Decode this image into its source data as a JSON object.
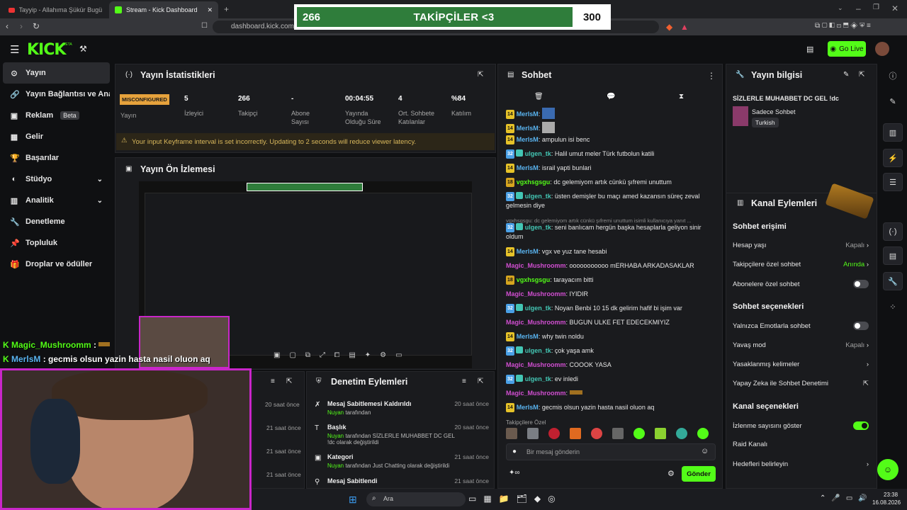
{
  "browser": {
    "tabs": [
      "Tayyip - Allahıma Şükür Bugün d...",
      "Stream - Kick Dashboard"
    ],
    "url": "dashboard.kick.com/st"
  },
  "goal": {
    "current": "266",
    "label": "TAKİPÇİLER <3",
    "target": "300",
    "fraction": 0.887
  },
  "kick": {
    "logo": "KICK",
    "beta": "BETA",
    "go_live": "Go Live"
  },
  "sidebar": {
    "items": [
      {
        "label": "Yayın",
        "icon": "broadcast-icon"
      },
      {
        "label": "Yayın Bağlantısı ve Anahtarı",
        "icon": "link-icon"
      },
      {
        "label": "Reklam",
        "icon": "ad-icon",
        "badge": "Beta"
      },
      {
        "label": "Gelir",
        "icon": "revenue-icon"
      },
      {
        "label": "Başarılar",
        "icon": "trophy-icon"
      },
      {
        "label": "Stüdyo",
        "icon": "studio-icon"
      },
      {
        "label": "Analitik",
        "icon": "chart-icon"
      },
      {
        "label": "Denetleme",
        "icon": "wrench-icon"
      },
      {
        "label": "Topluluk",
        "icon": "pin-icon"
      },
      {
        "label": "Droplar ve ödüller",
        "icon": "gift-icon"
      }
    ]
  },
  "stats": {
    "title": "Yayın İstatistikleri",
    "status": "MISCONFIGURED",
    "status_label": "Yayın",
    "items": [
      {
        "value": "5",
        "label": "İzleyici"
      },
      {
        "value": "266",
        "label": "Takipçi"
      },
      {
        "value": "-",
        "label": "Abone Sayısı"
      },
      {
        "value": "00:04:55",
        "label": "Yayında Olduğu Süre"
      },
      {
        "value": "4",
        "label": "Ort. Sohbete Katılanlar"
      },
      {
        "value": "%84",
        "label": "Katılım"
      }
    ],
    "warning": "Your input Keyframe interval is set incorrectly. Updating to 2 seconds will reduce viewer latency."
  },
  "preview": {
    "title": "Yayın Ön İzlemesi"
  },
  "chat": {
    "title": "Sohbet",
    "messages": [
      {
        "badge": "14",
        "user": "MerlsM",
        "color": "#5ab4f0",
        "text": ""
      },
      {
        "badge": "14",
        "user": "MerlsM",
        "color": "#5ab4f0",
        "text": ""
      },
      {
        "badge": "14",
        "user": "MerlsM",
        "color": "#5ab4f0",
        "text": "ampulun isi benc"
      },
      {
        "badge": "32",
        "user": "ulgen_tk",
        "color": "#43c6b4",
        "text": "Halil umut meler Türk futbolun katili"
      },
      {
        "badge": "14",
        "user": "MerlsM",
        "color": "#5ab4f0",
        "text": "israil yapti bunlari"
      },
      {
        "badge": "18",
        "user": "vgxhsgsgu",
        "color": "#53fc18",
        "text": "dc gelemiyom artık cünkü şıfremi unuttum"
      },
      {
        "badge": "32",
        "user": "ulgen_tk",
        "color": "#43c6b4",
        "text": "üsten demişler bu maçı amed kazansın süreç zeval gelmesin diye"
      },
      {
        "badge": "",
        "user": "",
        "color": "#8a8a8a",
        "text": "vgxhsgsgu: dc gelemiyom artık cünkü şıfremi unuttum isimli kullanıcıya yanıt ..."
      },
      {
        "badge": "32",
        "user": "ulgen_tk",
        "color": "#43c6b4",
        "text": "seni banlıcam hergün başka hesaplarla geliyon sinir oldum"
      },
      {
        "badge": "14",
        "user": "MerlsM",
        "color": "#5ab4f0",
        "text": "vgx ve yuz tane hesabi"
      },
      {
        "badge": "",
        "user": "Magic_Mushroomm",
        "color": "#d04ed0",
        "text": "ooooooooooo mERHABA ARKADASAKLAR"
      },
      {
        "badge": "18",
        "user": "vgxhsgsgu",
        "color": "#53fc18",
        "text": "tarayacım bitti"
      },
      {
        "badge": "",
        "user": "Magic_Mushroomm",
        "color": "#d04ed0",
        "text": "IYIDIR"
      },
      {
        "badge": "32",
        "user": "ulgen_tk",
        "color": "#43c6b4",
        "text": "Noyan Benbi 10 15 dk gelirim hafif bi işim var"
      },
      {
        "badge": "",
        "user": "Magic_Mushroomm",
        "color": "#d04ed0",
        "text": "BUGUN ULKE FET EDECEKMIYIZ"
      },
      {
        "badge": "14",
        "user": "MerlsM",
        "color": "#5ab4f0",
        "text": "why twin noldu"
      },
      {
        "badge": "32",
        "user": "ulgen_tk",
        "color": "#43c6b4",
        "text": "çok yaşa amk"
      },
      {
        "badge": "",
        "user": "Magic_Mushroomm",
        "color": "#d04ed0",
        "text": "COOOK YASA"
      },
      {
        "badge": "32",
        "user": "ulgen_tk",
        "color": "#43c6b4",
        "text": "ev inledi"
      },
      {
        "badge": "",
        "user": "Magic_Mushroomm",
        "color": "#d04ed0",
        "text": ""
      },
      {
        "badge": "14",
        "user": "MerlsM",
        "color": "#5ab4f0",
        "text": "gecmis olsun yazin hasta nasil oluon aq"
      }
    ],
    "followers_only": "Takipçilere Özel",
    "placeholder": "Bir mesaj gönderin",
    "send": "Gönder"
  },
  "stream_info": {
    "title": "Yayın bilgisi",
    "stream_title": "SİZLERLE MUHABBET DC GEL !dc",
    "category": "Sadece Sohbet",
    "language": "Turkish"
  },
  "channel_actions": {
    "title": "Kanal Eylemleri",
    "sec1": "Sohbet erişimi",
    "rows1": [
      {
        "label": "Hesap yaşı",
        "value": "Kapalı"
      },
      {
        "label": "Takipçilere özel sohbet",
        "value": "Anında"
      },
      {
        "label": "Abonelere özel sohbet",
        "value": ""
      }
    ],
    "sec2": "Sohbet seçenekleri",
    "rows2": [
      {
        "label": "Yalnızca Emotlarla sohbet",
        "value": ""
      },
      {
        "label": "Yavaş mod",
        "value": "Kapalı"
      },
      {
        "label": "Yasaklanmış kelimeler",
        "value": ""
      },
      {
        "label": "Yapay Zeka ile Sohbet Denetimi",
        "value": ""
      }
    ],
    "sec3": "Kanal seçenekleri",
    "rows3": [
      {
        "label": "İzlenme sayısını göster",
        "value": ""
      },
      {
        "label": "Raid Kanalı",
        "value": ""
      },
      {
        "label": "Hedefleri belirleyin",
        "value": ""
      }
    ]
  },
  "mod": {
    "title": "Denetim Eylemleri",
    "left_times": [
      "20 saat önce",
      "21 saat önce",
      "21 saat önce",
      "21 saat önce"
    ],
    "actions": [
      {
        "title": "Mesaj Sabitlemesi Kaldırıldı",
        "who": "Nuyan",
        "rest": "tarafından",
        "time": "20 saat önce"
      },
      {
        "title": "Başlık",
        "who": "Nuyan",
        "rest": "tarafından SİZLERLE MUHABBET DC GEL !dc olarak değiştirildi",
        "time": "20 saat önce"
      },
      {
        "title": "Kategori",
        "who": "Nuyan",
        "rest": "tarafından Just Chatting olarak değiştirildi",
        "time": "21 saat önce"
      },
      {
        "title": "Mesaj Sabitlendi",
        "who": "",
        "rest": "",
        "time": "21 saat önce"
      }
    ]
  },
  "overlay": {
    "chat1_user": "Magic_Mushroomm",
    "chat1_text": ":",
    "chat2_user": "MerlsM",
    "chat2_text": ": gecmis olsun yazin hasta nasil oluon aq"
  },
  "taskbar": {
    "search": "Ara",
    "time": "23:38",
    "date": "16.08.2026"
  }
}
